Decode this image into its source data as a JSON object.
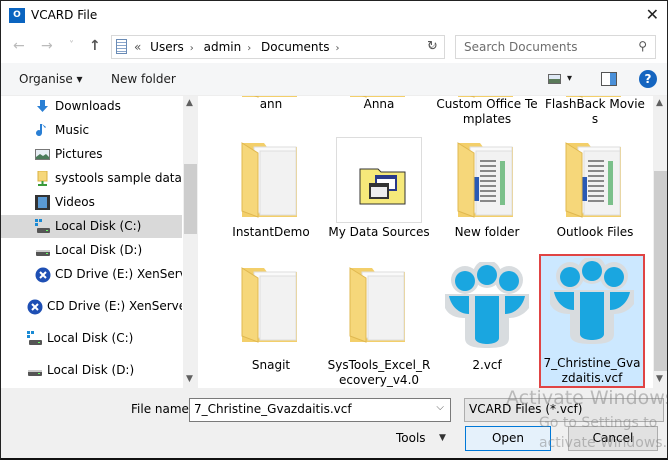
{
  "window": {
    "title": "VCARD File",
    "app_icon": "outlook-icon",
    "close_glyph": "✕"
  },
  "nav": {
    "back": "←",
    "forward": "→",
    "recent": "˅",
    "up": "↑",
    "breadcrumb": [
      "«",
      "Users",
      "admin",
      "Documents"
    ],
    "search_placeholder": "Search Documents"
  },
  "toolbar": {
    "organise": "Organise ▾",
    "new_folder": "New folder",
    "view_arrow": "▾",
    "help": "?"
  },
  "sidebar": {
    "items": [
      {
        "label": "Downloads",
        "icon": "downloads-icon",
        "indent": 1
      },
      {
        "label": "Music",
        "icon": "music-icon",
        "indent": 1
      },
      {
        "label": "Pictures",
        "icon": "pictures-icon",
        "indent": 1
      },
      {
        "label": "systools sample data (se",
        "icon": "network-folder-icon",
        "indent": 1
      },
      {
        "label": "Videos",
        "icon": "videos-icon",
        "indent": 1
      },
      {
        "label": "Local Disk (C:)",
        "icon": "system-drive-icon",
        "indent": 1,
        "selected": true
      },
      {
        "label": "Local Disk (D:)",
        "icon": "drive-icon",
        "indent": 1
      },
      {
        "label": "CD Drive (E:) XenServer T",
        "icon": "xenserver-cd-icon",
        "indent": 1
      },
      {
        "label": "CD Drive (E:) XenServer To",
        "icon": "xenserver-cd-icon",
        "indent": 0
      },
      {
        "label": "Local Disk (C:)",
        "icon": "system-drive-icon",
        "indent": 0
      },
      {
        "label": "Local Disk (D:)",
        "icon": "drive-icon",
        "indent": 0
      }
    ]
  },
  "files": [
    {
      "name": "ann",
      "type": "folder"
    },
    {
      "name": "Anna",
      "type": "folder"
    },
    {
      "name": "Custom Office Templates",
      "type": "folder"
    },
    {
      "name": "FlashBack Movies",
      "type": "folder"
    },
    {
      "name": "InstantDemo",
      "type": "folder"
    },
    {
      "name": "My Data Sources",
      "type": "datasource"
    },
    {
      "name": "New folder",
      "type": "folder-docs"
    },
    {
      "name": "Outlook Files",
      "type": "folder-docs"
    },
    {
      "name": "Snagit",
      "type": "folder"
    },
    {
      "name": "SysTools_Excel_Recovery_v4.0",
      "type": "folder"
    },
    {
      "name": "2.vcf",
      "type": "vcf"
    },
    {
      "name": "7_Christine_Gvazdaitis.vcf",
      "type": "vcf",
      "selected": true
    }
  ],
  "bottom": {
    "file_name_label": "File name:",
    "file_name_value": "7_Christine_Gvazdaitis.vcf",
    "filter": "VCARD Files (*.vcf)",
    "tools": "Tools",
    "open": "Open",
    "cancel": "Cancel"
  },
  "watermark": {
    "line1": "Activate Windows",
    "line2": "Go to Settings to activate Windows."
  },
  "colors": {
    "selection_bg": "#cce8ff",
    "selection_border": "#e04444",
    "vcf_blue": "#1aa6e0",
    "folder_yellow": "#f6d77a"
  }
}
